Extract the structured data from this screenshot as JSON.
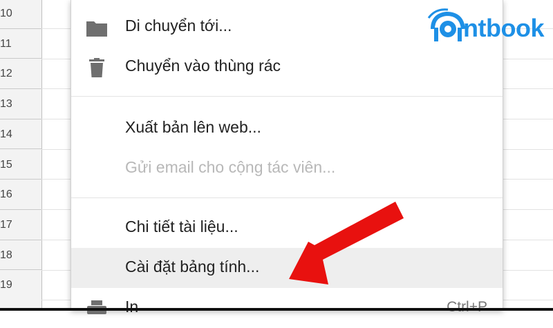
{
  "row_numbers": [
    "10",
    "11",
    "12",
    "13",
    "14",
    "15",
    "16",
    "17",
    "18",
    "19"
  ],
  "menu": {
    "items": [
      {
        "label": "Di chuyển tới...",
        "icon": "folder-icon",
        "enabled": true
      },
      {
        "label": "Chuyển vào thùng rác",
        "icon": "trash-icon",
        "enabled": true
      },
      {
        "label": "Xuất bản lên web...",
        "icon": "",
        "enabled": true
      },
      {
        "label": "Gửi email cho cộng tác viên...",
        "icon": "",
        "enabled": false
      },
      {
        "label": "Chi tiết tài liệu...",
        "icon": "",
        "enabled": true
      },
      {
        "label": "Cài đặt bảng tính...",
        "icon": "",
        "enabled": true,
        "highlighted": true
      },
      {
        "label": "In",
        "icon": "printer-icon",
        "enabled": true,
        "shortcut": "Ctrl+P"
      }
    ]
  },
  "logo": {
    "text": "ntbook"
  },
  "colors": {
    "accent": "#1e90e6",
    "arrow": "#e8110f",
    "highlight": "#eeeeee",
    "disabled_text": "#b8b8b8"
  }
}
